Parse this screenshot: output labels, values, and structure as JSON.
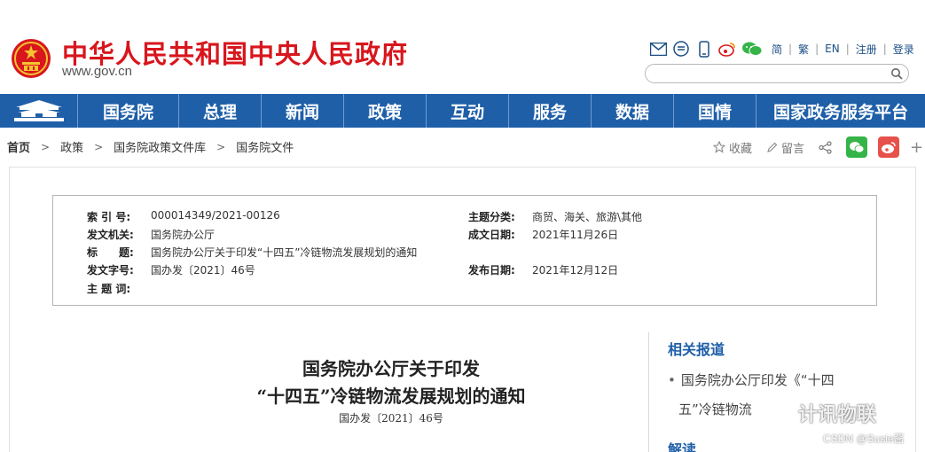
{
  "header": {
    "site_title": "中华人民共和国中央人民政府",
    "site_url": "www.gov.cn",
    "lang_links": [
      "简",
      "繁",
      "EN",
      "注册",
      "登录"
    ],
    "search_placeholder": ""
  },
  "nav": {
    "items": [
      "国务院",
      "总理",
      "新闻",
      "政策",
      "互动",
      "服务",
      "数据",
      "国情",
      "国家政务服务平台"
    ]
  },
  "breadcrumb": [
    "首页",
    "政策",
    "国务院政策文件库",
    "国务院文件"
  ],
  "page_actions": {
    "favorite": "收藏",
    "comment": "留言",
    "plus": "+"
  },
  "meta": {
    "index_label": "索 引 号:",
    "index_value": "000014349/2021-00126",
    "topic_label": "主题分类:",
    "topic_value": "商贸、海关、旅游\\其他",
    "issuer_label": "发文机关:",
    "issuer_value": "国务院办公厅",
    "date_written_label": "成文日期:",
    "date_written_value": "2021年11月26日",
    "title_label": "标　　题:",
    "title_value": "国务院办公厅关于印发“十四五”冷链物流发展规划的通知",
    "doc_no_label": "发文字号:",
    "doc_no_value": "国办发〔2021〕46号",
    "publish_label": "发布日期:",
    "publish_value": "2021年12月12日",
    "keywords_label": "主 题 词:",
    "keywords_value": ""
  },
  "document": {
    "title_line1": "国务院办公厅关于印发",
    "title_line2": "“十四五”冷链物流发展规划的通知",
    "number": "国办发〔2021〕46号"
  },
  "sidebar": {
    "related_title": "相关报道",
    "related_item_line1": "国务院办公厅印发《“十四",
    "related_item_line2": "五”冷链物流",
    "interpretation_title": "解读"
  },
  "watermark": {
    "main": "计讯物联",
    "sub": "CSDN @Susie酱"
  },
  "colors": {
    "brand_red": "#d8161d",
    "nav_blue": "#1f5fa8",
    "wechat_green": "#35b449",
    "weibo_red": "#e6524b"
  }
}
